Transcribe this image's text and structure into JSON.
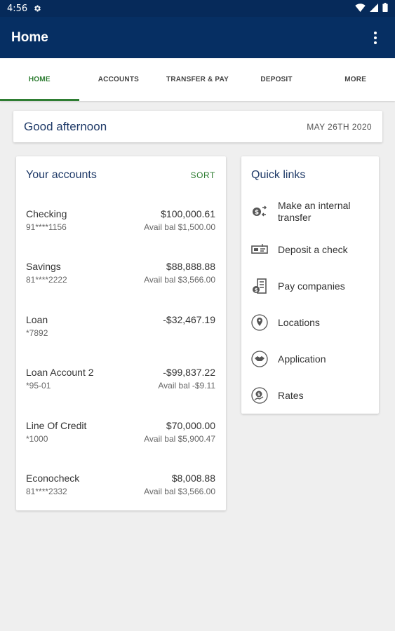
{
  "status_bar": {
    "time": "4:56"
  },
  "app_bar": {
    "title": "Home"
  },
  "tabs": [
    {
      "label": "HOME",
      "active": true
    },
    {
      "label": "ACCOUNTS",
      "active": false
    },
    {
      "label": "TRANSFER & PAY",
      "active": false
    },
    {
      "label": "DEPOSIT",
      "active": false
    },
    {
      "label": "MORE",
      "active": false
    }
  ],
  "greeting": {
    "text": "Good afternoon",
    "date": "MAY 26TH 2020"
  },
  "accounts": {
    "title": "Your accounts",
    "sort_label": "SORT",
    "items": [
      {
        "name": "Checking",
        "number": "91****1156",
        "amount": "$100,000.61",
        "avail": "Avail bal $1,500.00"
      },
      {
        "name": "Savings",
        "number": "81****2222",
        "amount": "$88,888.88",
        "avail": "Avail bal $3,566.00"
      },
      {
        "name": "Loan",
        "number": "*7892",
        "amount": "-$32,467.19",
        "avail": ""
      },
      {
        "name": "Loan Account 2",
        "number": "*95-01",
        "amount": "-$99,837.22",
        "avail": "Avail bal -$9.11"
      },
      {
        "name": "Line Of Credit",
        "number": "*1000",
        "amount": "$70,000.00",
        "avail": "Avail bal $5,900.47"
      },
      {
        "name": "Econocheck",
        "number": "81****2332",
        "amount": "$8,008.88",
        "avail": "Avail bal $3,566.00"
      }
    ]
  },
  "quick_links": {
    "title": "Quick links",
    "items": [
      {
        "label": "Make an internal transfer",
        "icon": "transfer-icon"
      },
      {
        "label": "Deposit a check",
        "icon": "deposit-check-icon"
      },
      {
        "label": "Pay companies",
        "icon": "pay-companies-icon"
      },
      {
        "label": "Locations",
        "icon": "location-pin-icon"
      },
      {
        "label": "Application",
        "icon": "handshake-icon"
      },
      {
        "label": "Rates",
        "icon": "rates-icon"
      }
    ]
  },
  "colors": {
    "status_bar": "#062a5a",
    "app_bar": "#062f63",
    "accent_green": "#2e7d32",
    "heading_blue": "#1f3a68",
    "background": "#efefef"
  }
}
